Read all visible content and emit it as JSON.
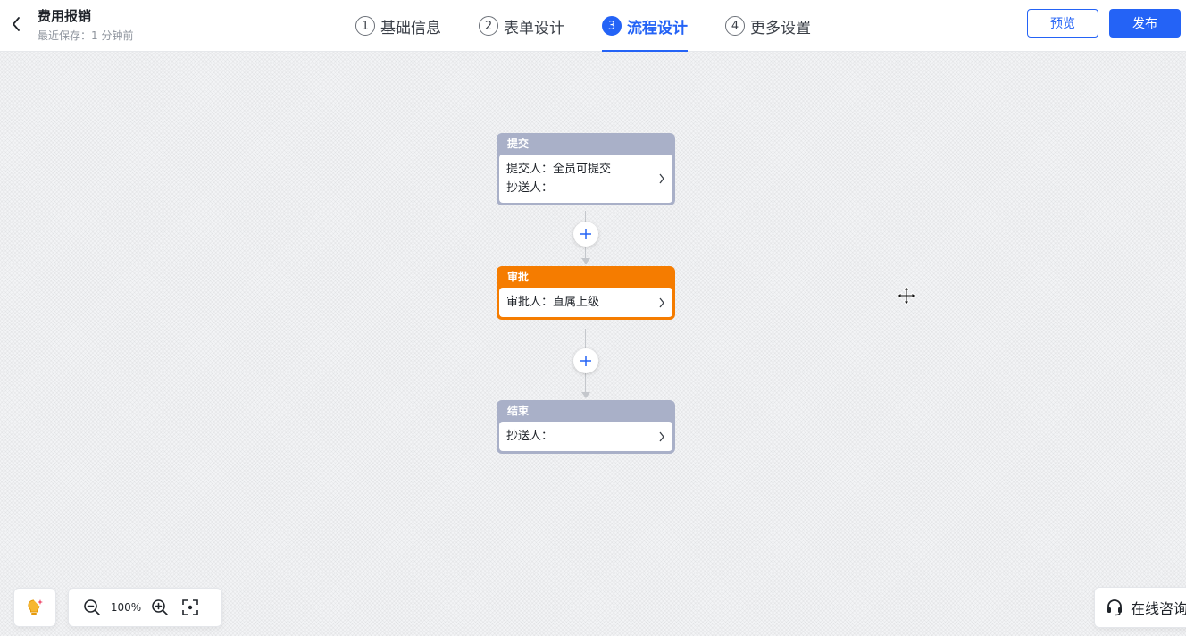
{
  "header": {
    "title": "费用报销",
    "subtitle": "最近保存：1 分钟前",
    "steps": [
      {
        "num": "1",
        "label": "基础信息"
      },
      {
        "num": "2",
        "label": "表单设计"
      },
      {
        "num": "3",
        "label": "流程设计"
      },
      {
        "num": "4",
        "label": "更多设置"
      }
    ],
    "active_step": "流程设计",
    "preview_label": "预览",
    "publish_label": "发布"
  },
  "flow": {
    "nodes": [
      {
        "title": "提交",
        "lines": [
          "提交人：全员可提交",
          "抄送人："
        ],
        "color": "#a9b0c8"
      },
      {
        "title": "审批",
        "lines": [
          "审批人：直属上级"
        ],
        "color": "#f57c00"
      },
      {
        "title": "结束",
        "lines": [
          "抄送人："
        ],
        "color": "#a9b0c8"
      }
    ]
  },
  "toolbar": {
    "zoom_level": "100%",
    "consult_label": "在线咨询"
  },
  "colors": {
    "accent": "#2463f6",
    "approval_node": "#f57c00",
    "default_node": "#a9b0c8"
  }
}
